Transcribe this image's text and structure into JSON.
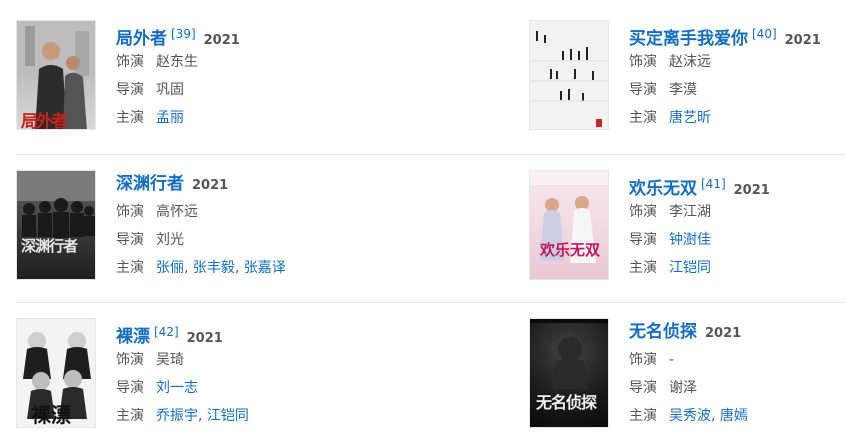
{
  "labels": {
    "role": "饰演",
    "director": "导演",
    "star": "主演"
  },
  "separator": ",",
  "items": [
    {
      "title": "局外者",
      "ref": "[39]",
      "year": "2021",
      "role": "赵东生",
      "director": "巩固",
      "stars": [
        "孟丽"
      ],
      "poster_text": "局外者"
    },
    {
      "title": "买定离手我爱你",
      "ref": "[40]",
      "year": "2021",
      "role": "赵沫远",
      "director": "李漠",
      "stars": [
        "唐艺昕"
      ]
    },
    {
      "title": "深渊行者",
      "ref": "",
      "year": "2021",
      "role": "高怀远",
      "director": "刘光",
      "stars": [
        "张俪",
        "张丰毅",
        "张嘉译"
      ],
      "poster_text": "深渊行者"
    },
    {
      "title": "欢乐无双",
      "ref": "[41]",
      "year": "2021",
      "role": "李江湖",
      "director": "钟澍佳",
      "stars": [
        "江铠同"
      ],
      "poster_text": "欢乐无双"
    },
    {
      "title": "裸漂",
      "ref": "[42]",
      "year": "2021",
      "role": "吴琦",
      "director": "刘一志",
      "stars": [
        "乔振宇",
        "江铠同"
      ],
      "poster_text": "裸漂"
    },
    {
      "title": "无名侦探",
      "ref": "",
      "year": "2021",
      "role": "-",
      "director": "谢泽",
      "stars": [
        "吴秀波",
        "唐嫣"
      ],
      "poster_text": "无名侦探"
    }
  ],
  "colors": {
    "link": "#136ec2",
    "text": "#555555",
    "divider": "#e8e8e8"
  }
}
